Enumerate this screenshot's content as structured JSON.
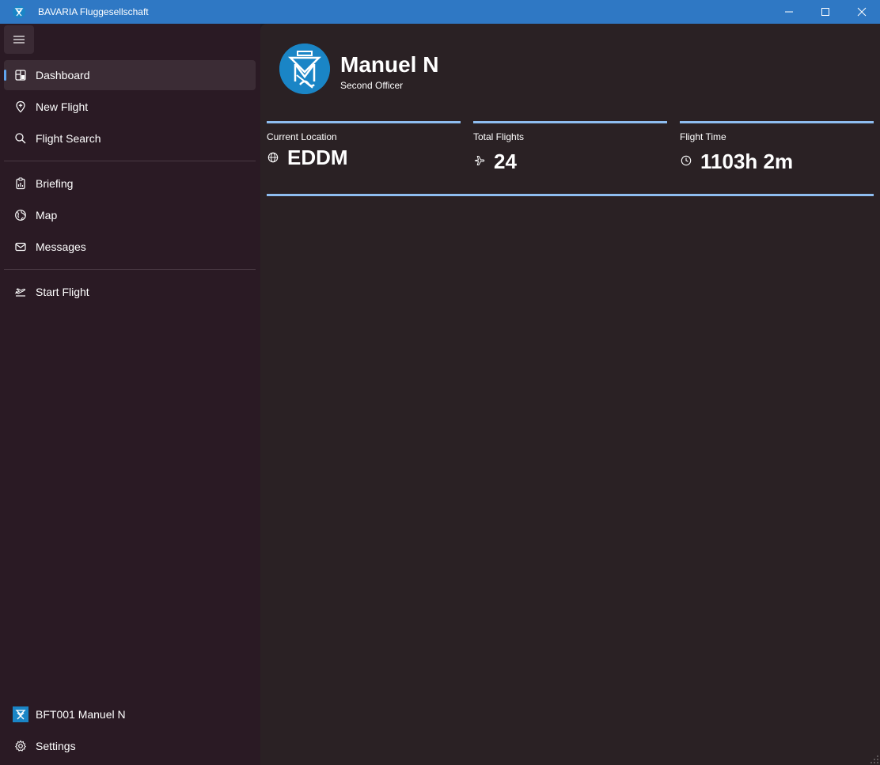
{
  "window": {
    "title": "BAVARIA Fluggesellschaft",
    "accent_color": "#2f78c4"
  },
  "sidebar": {
    "menu_icon": "hamburger-icon",
    "primary_items": [
      {
        "label": "Dashboard",
        "icon": "dashboard-icon",
        "selected": true
      },
      {
        "label": "New Flight",
        "icon": "location-pin-icon"
      },
      {
        "label": "Flight Search",
        "icon": "search-icon"
      }
    ],
    "secondary_items": [
      {
        "label": "Briefing",
        "icon": "clipboard-icon"
      },
      {
        "label": "Map",
        "icon": "globe-icon"
      },
      {
        "label": "Messages",
        "icon": "mail-icon"
      }
    ],
    "tertiary_items": [
      {
        "label": "Start Flight",
        "icon": "takeoff-icon"
      }
    ],
    "footer": {
      "account_label": "BFT001 Manuel N",
      "settings_label": "Settings"
    }
  },
  "profile": {
    "name": "Manuel N",
    "rank": "Second Officer"
  },
  "stats": [
    {
      "label": "Current Location",
      "value": "EDDM",
      "icon": "globe-icon"
    },
    {
      "label": "Total Flights",
      "value": "24",
      "icon": "airplane-icon"
    },
    {
      "label": "Flight Time",
      "value": "1103h 2m",
      "icon": "clock-icon"
    }
  ],
  "colors": {
    "selection_indicator": "#60a5f0",
    "stat_bar": "#8ebdf0",
    "avatar_bg": "#1a85c6"
  }
}
